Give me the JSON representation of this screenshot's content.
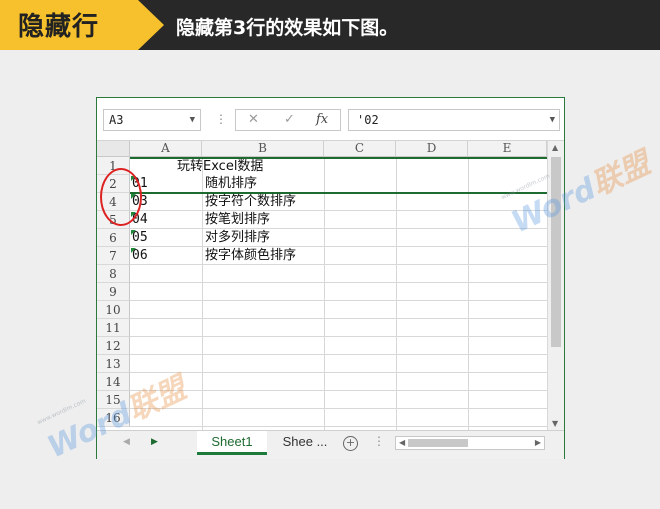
{
  "banner": {
    "tag": "隐藏行",
    "title": "隐藏第3行的效果如下图。"
  },
  "excel": {
    "name_box": "A3",
    "formula_buttons": {
      "cancel": "✕",
      "enter": "✓",
      "function": "fx"
    },
    "formula_value": "'02",
    "columns": [
      "A",
      "B",
      "C",
      "D",
      "E"
    ],
    "rows": [
      "1",
      "2",
      "4",
      "5",
      "6",
      "7",
      "8",
      "9",
      "10",
      "11",
      "12",
      "13",
      "14",
      "15",
      "16"
    ],
    "cells": {
      "r1_title": "玩转Excel数据",
      "r2_a": "01",
      "r2_b": "随机排序",
      "r4_a": "03",
      "r4_b": "按字符个数排序",
      "r5_a": "04",
      "r5_b": "按笔划排序",
      "r6_a": "05",
      "r6_b": "对多列排序",
      "r7_a": "06",
      "r7_b": "按字体颜色排序"
    },
    "sheets": [
      "Sheet1",
      "Shee ..."
    ],
    "add_sheet": "+",
    "tab_dots": "⋮"
  },
  "watermark": {
    "brand_en": "Word",
    "brand_cn": "联盟",
    "site": "www.wordlm.com"
  },
  "colors": {
    "banner_bg": "#282828",
    "tag_bg": "#f6c12c",
    "excel_green": "#1e6b30",
    "highlight_red": "#dd2222"
  }
}
